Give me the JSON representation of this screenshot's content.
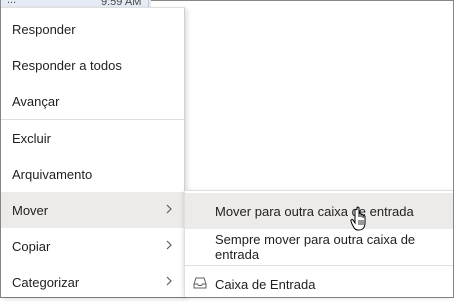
{
  "background": {
    "time": "9:59 AM",
    "dots": "..."
  },
  "context_menu": {
    "items": [
      {
        "label": "Responder",
        "has_submenu": false
      },
      {
        "label": "Responder a todos",
        "has_submenu": false
      },
      {
        "label": "Avançar",
        "has_submenu": false
      },
      {
        "label": "Excluir",
        "has_submenu": false
      },
      {
        "label": "Arquivamento",
        "has_submenu": false
      },
      {
        "label": "Mover",
        "has_submenu": true,
        "hovered": true
      },
      {
        "label": "Copiar",
        "has_submenu": true
      },
      {
        "label": "Categorizar",
        "has_submenu": true
      }
    ]
  },
  "submenu": {
    "items": [
      {
        "label": "Mover para outra caixa de entrada",
        "hovered": true
      },
      {
        "label": "Sempre mover para outra caixa de entrada"
      },
      {
        "label": "Caixa de Entrada",
        "icon": "inbox-icon"
      }
    ]
  },
  "colors": {
    "hover_bg": "#edebe9",
    "text": "#201f1e",
    "separator": "#e1dfdd"
  }
}
